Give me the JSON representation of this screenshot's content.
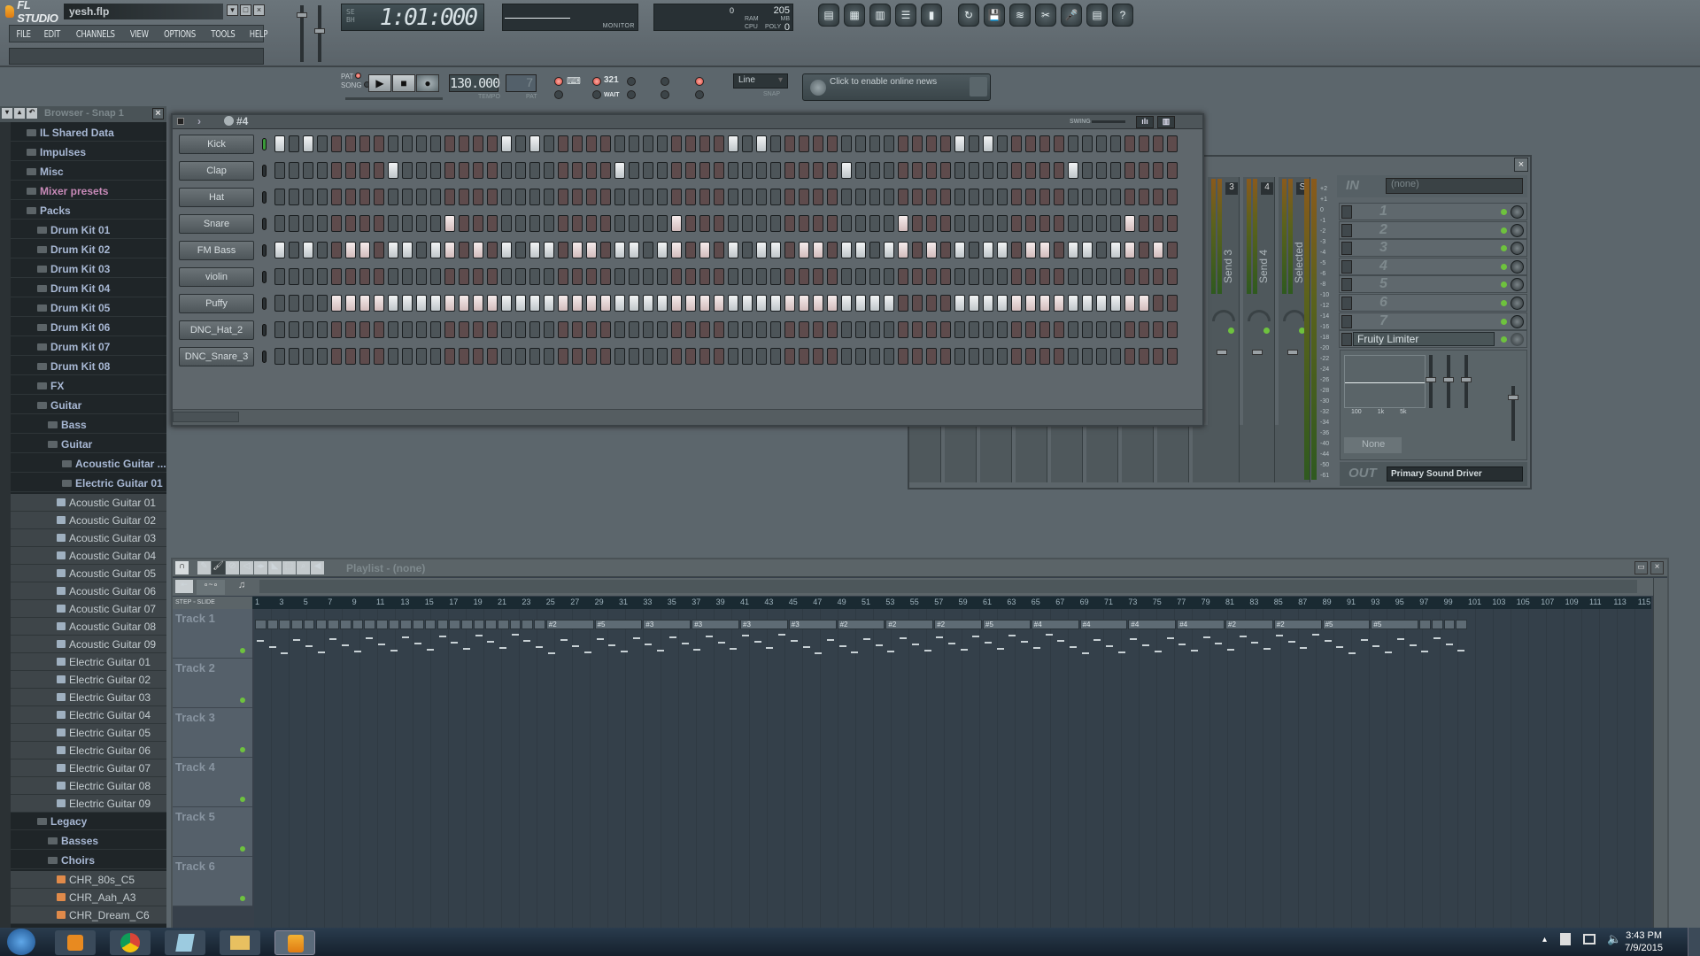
{
  "app": {
    "name": "FL STUDIO",
    "file": "yesh.flp"
  },
  "menu": [
    "FILE",
    "EDIT",
    "CHANNELS",
    "VIEW",
    "OPTIONS",
    "TOOLS",
    "HELP"
  ],
  "time_display": {
    "value": "1:01:000",
    "mode_top": "SE",
    "mode_bottom": "BH"
  },
  "monitor_label": "MONITOR",
  "performance": {
    "cpu_label": "CPU",
    "poly_label": "POLY",
    "ram_label": "RAM",
    "mb_label": "MB",
    "ram_mb": "205",
    "cpu": "0",
    "poly": "0"
  },
  "toolbar_icons": [
    "playlist-icon",
    "step-sequencer-icon",
    "piano-roll-icon",
    "browser-icon",
    "mixer-icon",
    "undo-icon",
    "save-icon",
    "export-wave-icon",
    "cut-icon",
    "record-mic-icon",
    "project-info-icon",
    "help-icon"
  ],
  "transport": {
    "pat_label": "PAT",
    "song_label": "SONG",
    "tempo": "130.000",
    "tempo_label": "TEMPO",
    "pattern": "7",
    "pat_display_label": "PAT",
    "snap_value": "Line",
    "snap_label": "SNAP",
    "news_text": "Click to enable online news",
    "countdown_label": "321",
    "wait_label": "WAIT"
  },
  "browser": {
    "title": "Browser - Snap 1",
    "items": [
      {
        "label": "IL Shared Data",
        "level": 0,
        "type": "folder"
      },
      {
        "label": "Impulses",
        "level": 0,
        "type": "folder"
      },
      {
        "label": "Misc",
        "level": 0,
        "type": "folder"
      },
      {
        "label": "Mixer presets",
        "level": 0,
        "type": "preset"
      },
      {
        "label": "Packs",
        "level": 0,
        "type": "folder"
      },
      {
        "label": "Drum Kit 01",
        "level": 1,
        "type": "folder"
      },
      {
        "label": "Drum Kit 02",
        "level": 1,
        "type": "folder"
      },
      {
        "label": "Drum Kit 03",
        "level": 1,
        "type": "folder"
      },
      {
        "label": "Drum Kit 04",
        "level": 1,
        "type": "folder"
      },
      {
        "label": "Drum Kit 05",
        "level": 1,
        "type": "folder"
      },
      {
        "label": "Drum Kit 06",
        "level": 1,
        "type": "folder"
      },
      {
        "label": "Drum Kit 07",
        "level": 1,
        "type": "folder"
      },
      {
        "label": "Drum Kit 08",
        "level": 1,
        "type": "folder"
      },
      {
        "label": "FX",
        "level": 1,
        "type": "folder"
      },
      {
        "label": "Guitar",
        "level": 1,
        "type": "folder"
      },
      {
        "label": "Bass",
        "level": 2,
        "type": "folder"
      },
      {
        "label": "Guitar",
        "level": 2,
        "type": "folder"
      },
      {
        "label": "Acoustic Guitar ...",
        "level": 3,
        "type": "folder"
      },
      {
        "label": "Electric Guitar 01",
        "level": 3,
        "type": "folder"
      },
      {
        "label": "Acoustic Guitar 01",
        "level": 4,
        "type": "file"
      },
      {
        "label": "Acoustic Guitar 02",
        "level": 4,
        "type": "file"
      },
      {
        "label": "Acoustic Guitar 03",
        "level": 4,
        "type": "file"
      },
      {
        "label": "Acoustic Guitar 04",
        "level": 4,
        "type": "file"
      },
      {
        "label": "Acoustic Guitar 05",
        "level": 4,
        "type": "file"
      },
      {
        "label": "Acoustic Guitar 06",
        "level": 4,
        "type": "file"
      },
      {
        "label": "Acoustic Guitar 07",
        "level": 4,
        "type": "file"
      },
      {
        "label": "Acoustic Guitar 08",
        "level": 4,
        "type": "file"
      },
      {
        "label": "Acoustic Guitar 09",
        "level": 4,
        "type": "file"
      },
      {
        "label": "Electric Guitar 01",
        "level": 4,
        "type": "file"
      },
      {
        "label": "Electric Guitar 02",
        "level": 4,
        "type": "file"
      },
      {
        "label": "Electric Guitar 03",
        "level": 4,
        "type": "file"
      },
      {
        "label": "Electric Guitar 04",
        "level": 4,
        "type": "file"
      },
      {
        "label": "Electric Guitar 05",
        "level": 4,
        "type": "file"
      },
      {
        "label": "Electric Guitar 06",
        "level": 4,
        "type": "file"
      },
      {
        "label": "Electric Guitar 07",
        "level": 4,
        "type": "file"
      },
      {
        "label": "Electric Guitar 08",
        "level": 4,
        "type": "file"
      },
      {
        "label": "Electric Guitar 09",
        "level": 4,
        "type": "file"
      },
      {
        "label": "Legacy",
        "level": 1,
        "type": "folder"
      },
      {
        "label": "Basses",
        "level": 2,
        "type": "folder"
      },
      {
        "label": "Choirs",
        "level": 2,
        "type": "folder"
      },
      {
        "label": "CHR_80s_C5",
        "level": 4,
        "type": "sample"
      },
      {
        "label": "CHR_Aah_A3",
        "level": 4,
        "type": "sample"
      },
      {
        "label": "CHR_Dream_C6",
        "level": 4,
        "type": "sample"
      }
    ]
  },
  "channel_rack": {
    "pattern": "#4",
    "swing_label": "SWING",
    "steps": 64,
    "channels": [
      {
        "name": "Kick",
        "selected": true,
        "active": [
          0,
          2,
          16,
          18,
          32,
          34,
          48,
          50
        ]
      },
      {
        "name": "Clap",
        "selected": false,
        "active": [
          8,
          24,
          40,
          56
        ]
      },
      {
        "name": "Hat",
        "selected": false,
        "active": []
      },
      {
        "name": "Snare",
        "selected": false,
        "active": [
          12,
          28,
          44,
          60
        ]
      },
      {
        "name": "FM Bass",
        "selected": false,
        "active": [
          0,
          2,
          5,
          6,
          8,
          9,
          11,
          12,
          14,
          16,
          18,
          19,
          21,
          22,
          24,
          25,
          27,
          28,
          30,
          32,
          34,
          35,
          37,
          38,
          40,
          41,
          43,
          44,
          46,
          48,
          50,
          51,
          53,
          54,
          56,
          57,
          59,
          60,
          62
        ]
      },
      {
        "name": "violin",
        "selected": false,
        "active": []
      },
      {
        "name": "Puffy",
        "selected": false,
        "active": [
          4,
          5,
          6,
          7,
          8,
          9,
          10,
          11,
          12,
          13,
          14,
          15,
          16,
          17,
          18,
          19,
          20,
          21,
          22,
          23,
          24,
          25,
          26,
          27,
          28,
          29,
          30,
          31,
          32,
          33,
          34,
          35,
          36,
          37,
          38,
          39,
          40,
          41,
          42,
          43,
          48,
          49,
          50,
          51,
          52,
          53,
          54,
          55,
          56,
          57,
          58,
          59,
          60,
          61
        ]
      },
      {
        "name": "DNC_Hat_2",
        "selected": false,
        "active": []
      },
      {
        "name": "DNC_Snare_3",
        "selected": false,
        "active": []
      }
    ]
  },
  "mixer": {
    "in_label": "IN",
    "in_value": "(none)",
    "strips": [
      {
        "label": "Send 3",
        "snd": "3"
      },
      {
        "label": "Send 4",
        "snd": "4"
      },
      {
        "label": "Selected",
        "snd": "S"
      }
    ],
    "slots": [
      "1",
      "2",
      "3",
      "4",
      "5",
      "6",
      "7"
    ],
    "effect": "Fruity Limiter",
    "eq_labels": [
      "100",
      "1k",
      "5k"
    ],
    "preset_none": "None",
    "out_label": "OUT",
    "out_device": "Primary Sound Driver",
    "db_scale": [
      "+2",
      "+1",
      "0",
      "-1",
      "-2",
      "-3",
      "-4",
      "-5",
      "-6",
      "-8",
      "-10",
      "-12",
      "-14",
      "-16",
      "-18",
      "-20",
      "-22",
      "-24",
      "-26",
      "-28",
      "-30",
      "-32",
      "-34",
      "-36",
      "-40",
      "-44",
      "-50",
      "-61"
    ]
  },
  "playlist": {
    "title": "Playlist - (none)",
    "step_label": "STEP",
    "slide_label": "SLIDE",
    "ruler": [
      "1",
      "3",
      "5",
      "7",
      "9",
      "11",
      "13",
      "15",
      "17",
      "19",
      "21",
      "23",
      "25",
      "27",
      "29",
      "31",
      "33",
      "35",
      "37",
      "39",
      "41",
      "43",
      "45",
      "47",
      "49",
      "51",
      "53",
      "55",
      "57",
      "59",
      "61",
      "63",
      "65",
      "67",
      "69",
      "71",
      "73",
      "75",
      "77",
      "79",
      "81",
      "83",
      "85",
      "87",
      "89",
      "91",
      "93",
      "95",
      "97",
      "99",
      "101",
      "103",
      "105",
      "107",
      "109",
      "111",
      "113",
      "115"
    ],
    "tracks": [
      "Track 1",
      "Track 2",
      "Track 3",
      "Track 4",
      "Track 5",
      "Track 6"
    ],
    "clips": [
      {
        "start": 25,
        "label": "#2"
      },
      {
        "start": 29,
        "label": "#5"
      },
      {
        "start": 33,
        "label": "#3"
      },
      {
        "start": 37,
        "label": "#3"
      },
      {
        "start": 41,
        "label": "#3"
      },
      {
        "start": 45,
        "label": "#3"
      },
      {
        "start": 49,
        "label": "#2"
      },
      {
        "start": 53,
        "label": "#2"
      },
      {
        "start": 57,
        "label": "#2"
      },
      {
        "start": 61,
        "label": "#5"
      },
      {
        "start": 65,
        "label": "#4"
      },
      {
        "start": 69,
        "label": "#4"
      },
      {
        "start": 73,
        "label": "#4"
      },
      {
        "start": 77,
        "label": "#4"
      },
      {
        "start": 81,
        "label": "#2"
      },
      {
        "start": 85,
        "label": "#2"
      },
      {
        "start": 89,
        "label": "#5"
      },
      {
        "start": 93,
        "label": "#5"
      }
    ]
  },
  "taskbar": {
    "time": "3:43 PM",
    "date": "7/9/2015"
  }
}
